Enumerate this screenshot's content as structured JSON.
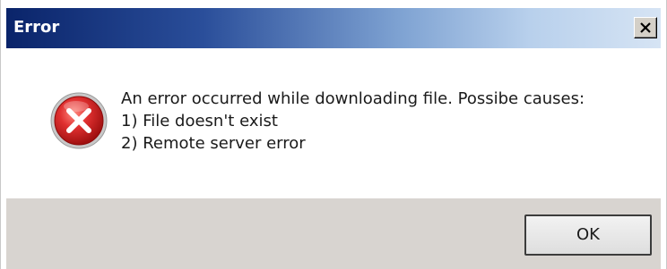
{
  "window": {
    "title": "Error"
  },
  "titlebar": {
    "close_icon": "close-x-icon"
  },
  "dialog": {
    "icon": "error-icon",
    "message_lines": [
      "An error occurred while downloading file. Possibe causes:",
      "1) File doesn't exist",
      "2) Remote server error"
    ]
  },
  "buttons": {
    "ok_label": "OK"
  },
  "colors": {
    "title_start": "#0a246a",
    "title_end": "#d6e4f4",
    "error_red": "#d42020",
    "button_bar": "#d8d4d0"
  }
}
